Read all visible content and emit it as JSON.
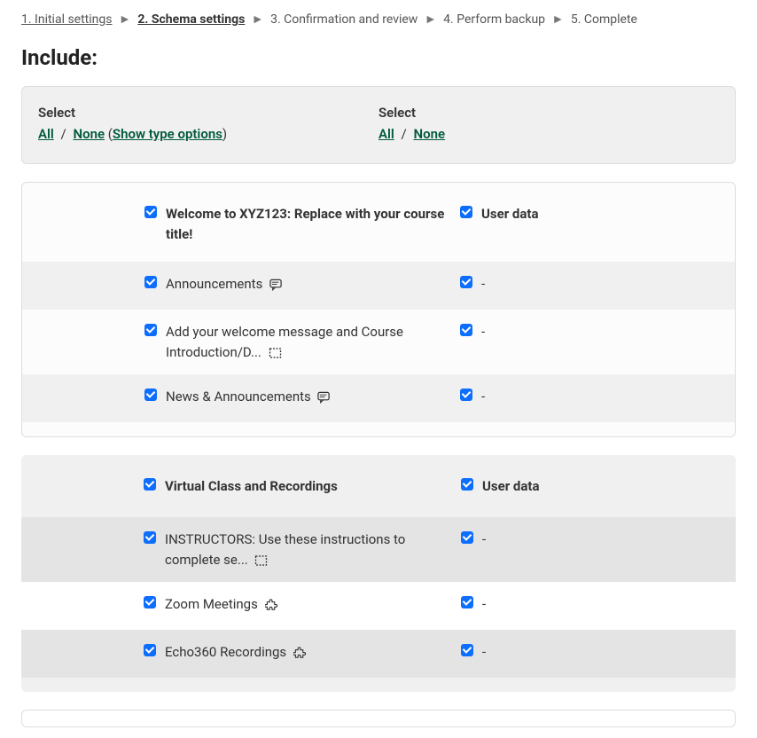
{
  "breadcrumb": {
    "steps": [
      "1. Initial settings",
      "2. Schema settings",
      "3. Confirmation and review",
      "4. Perform backup",
      "5. Complete"
    ],
    "sep": "►",
    "active_index": 1
  },
  "heading": "Include:",
  "selector": {
    "label": "Select",
    "all": "All",
    "none": "None",
    "show_type": "Show type options",
    "slash": "/"
  },
  "sections": [
    {
      "title": "Welcome to XYZ123: Replace with your course title!",
      "user_data_label": "User data",
      "items": [
        {
          "label": "Announcements",
          "icon": "text-bubble",
          "right": "-",
          "shade": true
        },
        {
          "label": "Add your welcome message and Course Introduction/D...",
          "icon": "dashed-box",
          "right": "-",
          "shade": false
        },
        {
          "label": "News & Announcements",
          "icon": "text-bubble",
          "right": "-",
          "shade": true
        }
      ]
    },
    {
      "title": "Virtual Class and Recordings",
      "user_data_label": "User data",
      "alt": true,
      "items": [
        {
          "label": "INSTRUCTORS: Use these instructions to complete se...",
          "icon": "dashed-box",
          "right": "-",
          "shade_dark": true
        },
        {
          "label": "Zoom Meetings",
          "icon": "puzzle",
          "right": "-",
          "shade": false
        },
        {
          "label": "Echo360 Recordings",
          "icon": "puzzle",
          "right": "-",
          "shade_dark": true
        }
      ]
    }
  ]
}
